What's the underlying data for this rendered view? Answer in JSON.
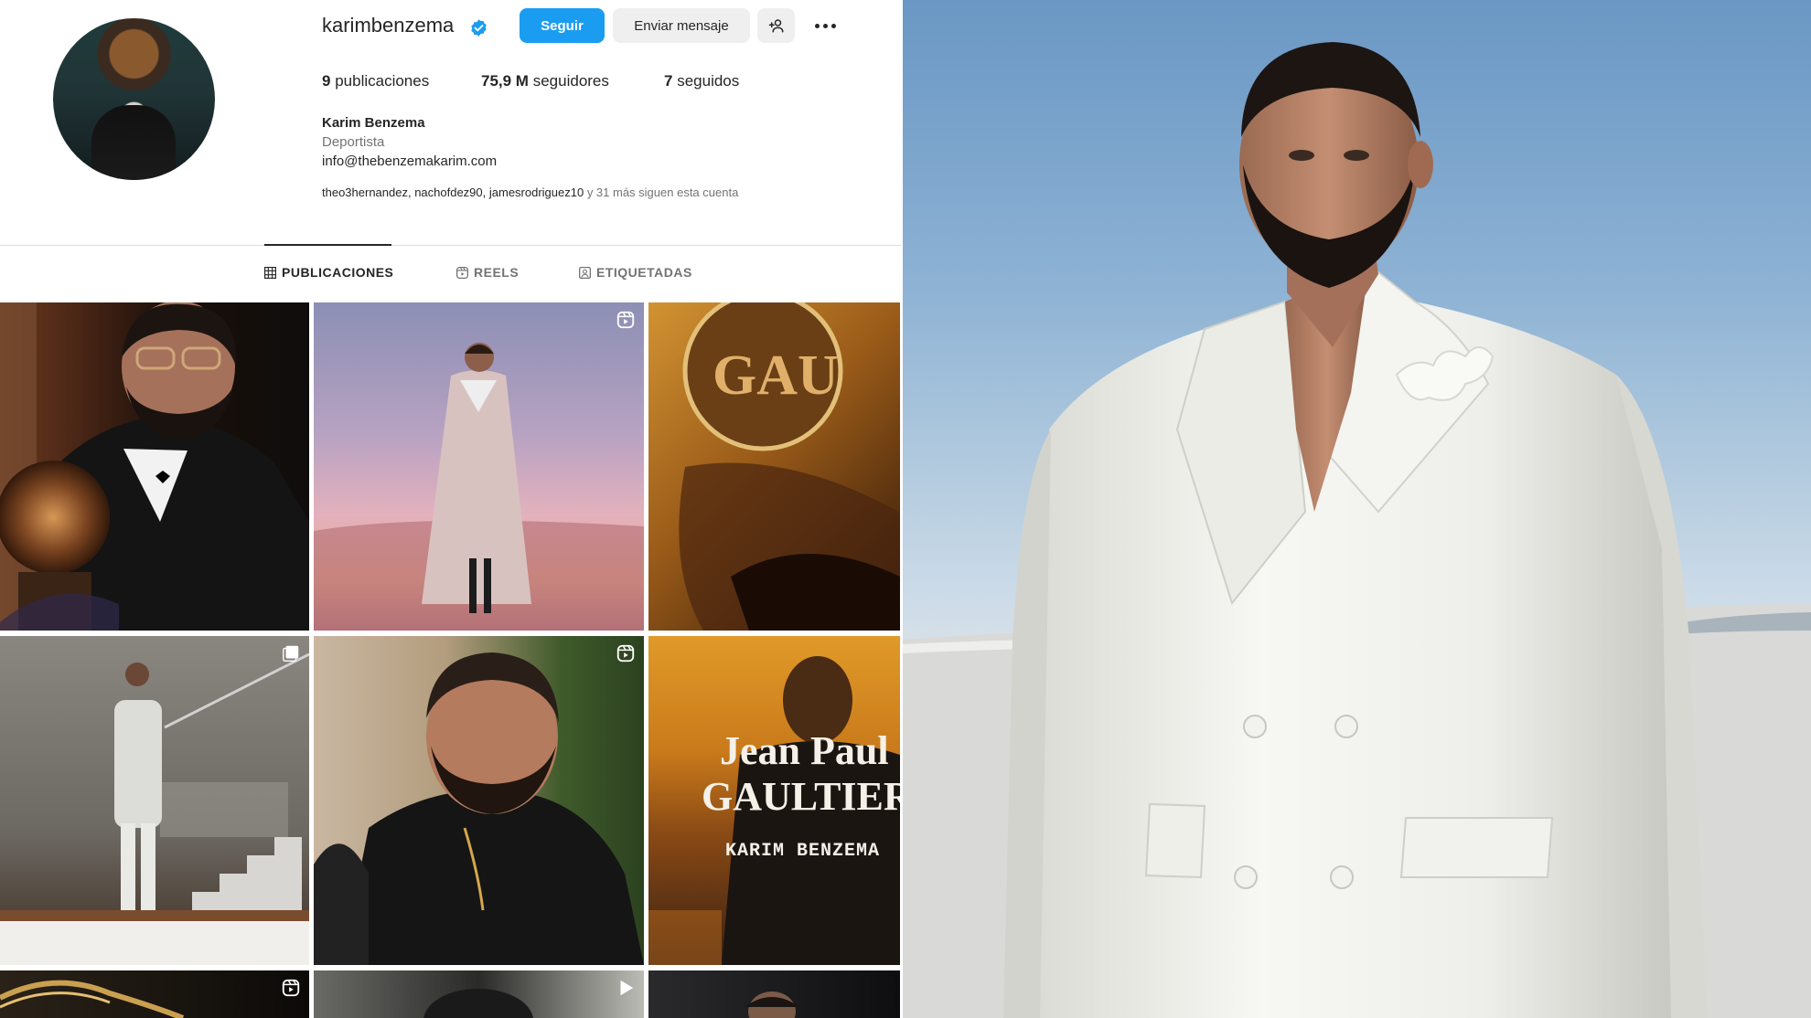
{
  "profile": {
    "username": "karimbenzema",
    "verified": true,
    "follow_label": "Seguir",
    "message_label": "Enviar mensaje",
    "add_icon": "person-plus-icon",
    "more_icon": "more-horizontal-icon",
    "stats": {
      "posts_count": "9",
      "posts_label": "publicaciones",
      "followers_count": "75,9 M",
      "followers_label": "seguidores",
      "following_count": "7",
      "following_label": "seguidos"
    },
    "full_name": "Karim Benzema",
    "category": "Deportista",
    "email": "info@thebenzemakarim.com",
    "followed_by_names": "theo3hernandez, nachofdez90, jamesrodriguez10",
    "followed_by_suffix": " y 31 más siguen esta cuenta"
  },
  "tabs": [
    {
      "label": "PUBLICACIONES",
      "icon": "grid-icon",
      "active": true
    },
    {
      "label": "REELS",
      "icon": "reels-icon",
      "active": false
    },
    {
      "label": "ETIQUETADAS",
      "icon": "tagged-icon",
      "active": false
    }
  ],
  "grid": {
    "tiles": [
      {
        "subject": "tuxedo-trophy",
        "badge": null
      },
      {
        "subject": "pink-coat-sky",
        "badge": "reels-icon"
      },
      {
        "subject": "sunglasses-closeup",
        "badge": null
      },
      {
        "subject": "concrete-stairs",
        "badge": "carousel-icon"
      },
      {
        "subject": "black-shirt-portrait",
        "badge": "reels-icon"
      },
      {
        "subject": "jpg-poster",
        "badge": null
      },
      {
        "subject": "gold-chain",
        "badge": "reels-icon"
      },
      {
        "subject": "dark-portrait",
        "badge": "play-icon"
      },
      {
        "subject": "car-interior",
        "badge": null
      }
    ],
    "poster_brand_line1": "Jean Paul",
    "poster_brand_line2": "GAULTIER",
    "poster_name": "KARIM BENZEMA",
    "sunglasses_text": "GAU"
  },
  "colors": {
    "accent": "#1a9df1",
    "verified": "#1a9df1",
    "muted_text": "#737373",
    "divider": "#dbdbdb"
  }
}
